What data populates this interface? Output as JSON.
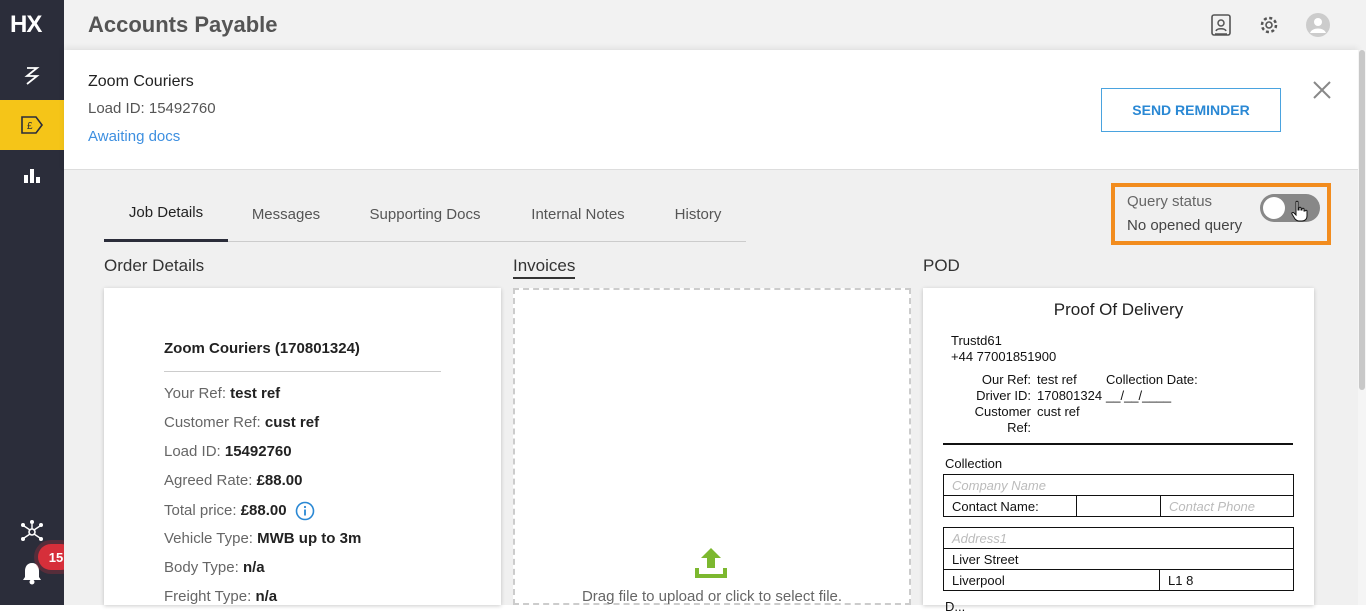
{
  "sidebar": {
    "logo": "HX",
    "badge_count": "15"
  },
  "topbar": {
    "title": "Accounts Payable"
  },
  "header": {
    "company": "Zoom Couriers",
    "load_id": "Load ID: 15492760",
    "status": "Awaiting docs",
    "send_reminder": "SEND REMINDER"
  },
  "tabs": [
    "Job Details",
    "Messages",
    "Supporting Docs",
    "Internal Notes",
    "History"
  ],
  "query": {
    "label": "Query status",
    "value": "No opened query"
  },
  "sections": {
    "order": "Order Details",
    "invoices": "Invoices",
    "pod": "POD"
  },
  "order": {
    "name": "Zoom Couriers (170801324)",
    "rows": [
      {
        "label": "Your Ref: ",
        "value": "test ref"
      },
      {
        "label": "Customer Ref: ",
        "value": "cust ref"
      },
      {
        "label": "Load ID: ",
        "value": "15492760"
      },
      {
        "label": "Agreed Rate: ",
        "value": "£88.00"
      },
      {
        "label": "Total price: ",
        "value": "£88.00"
      },
      {
        "label": "Vehicle Type: ",
        "value": "MWB up to 3m"
      },
      {
        "label": "Body Type: ",
        "value": "n/a"
      },
      {
        "label": "Freight Type: ",
        "value": "n/a"
      }
    ]
  },
  "invoices": {
    "drop_text": "Drag file to upload or click to select file."
  },
  "pod": {
    "title": "Proof Of Delivery",
    "company": "Trustd61",
    "phone": "+44 77001851900",
    "our_ref_label": "Our Ref:",
    "our_ref": "test ref",
    "collection_date_label": "Collection Date:",
    "driver_id_label": "Driver ID:",
    "driver_id": "170801324",
    "date_blank": "__/__/____",
    "customer_label": "Customer",
    "ref_label": "Ref:",
    "customer_ref": "cust ref",
    "collection_label": "Collection",
    "company_name_ph": "Company Name",
    "contact_name_label": "Contact Name:",
    "contact_phone_ph": "Contact Phone",
    "address1_ph": "Address1",
    "street": "Liver Street",
    "city": "Liverpool",
    "postcode": "L1 8",
    "cut_label": "D..."
  },
  "colors": {
    "sidebar": "#2b2d3a",
    "active_nav": "#f5c518",
    "accent_blue": "#2a88d4",
    "highlight": "#f28c1e",
    "badge": "#d62f3a",
    "upload_green": "#7cb82f"
  }
}
